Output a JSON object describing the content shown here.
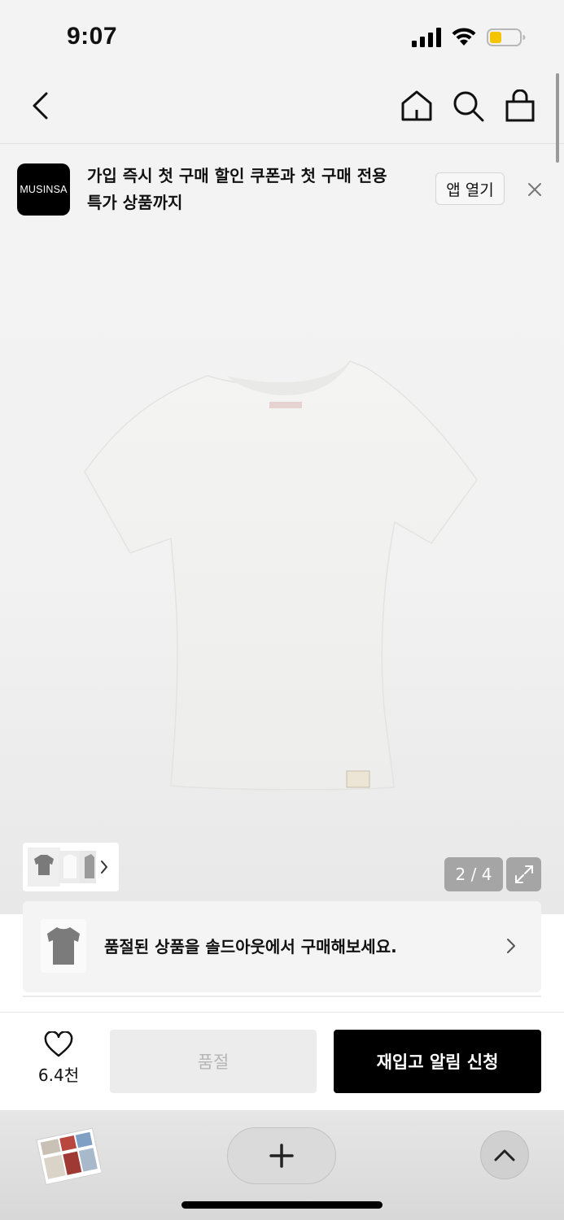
{
  "status_bar": {
    "time": "9:07",
    "battery_color": "#f5c400"
  },
  "nav": {
    "icons": [
      "back-icon",
      "home-icon",
      "search-icon",
      "cart-icon"
    ]
  },
  "banner": {
    "logo_text": "MUSINSA",
    "line1": "가입 즉시 첫 구매 할인 쿠폰과 첫 구매 전용",
    "line2": "특가 상품까지",
    "open_app_label": "앱 열기"
  },
  "gallery": {
    "counter": "2 / 4",
    "current": 2,
    "total": 4
  },
  "soldout_card": {
    "text": "품절된 상품을 솔드아웃에서 구매해보세요."
  },
  "actions": {
    "like_count": "6.4천",
    "soldout_label": "품절",
    "restock_label": "재입고 알림 신청"
  },
  "colors": {
    "primary_button": "#000000",
    "disabled_button": "#ececec"
  }
}
